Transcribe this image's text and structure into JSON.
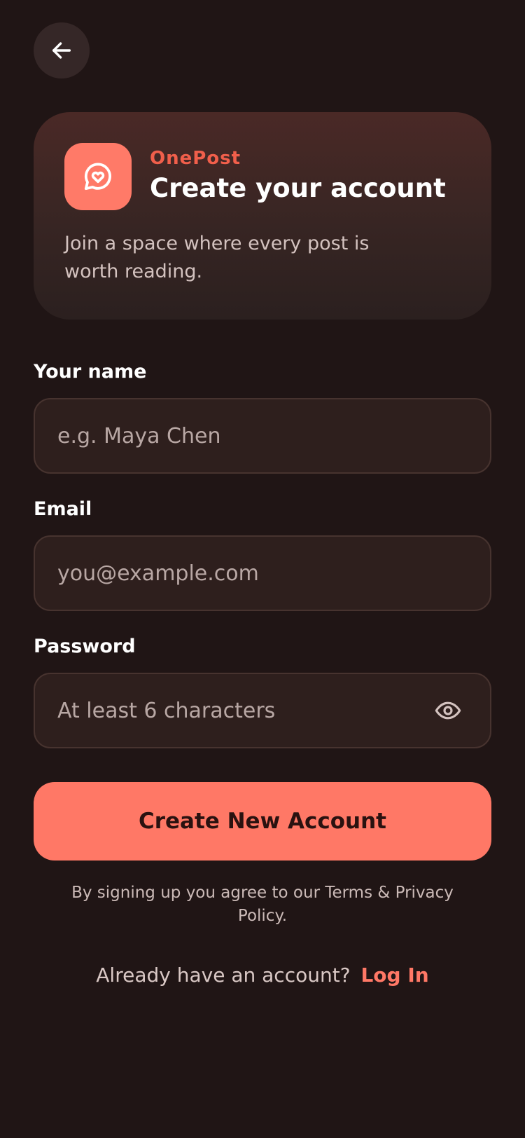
{
  "header": {
    "back_icon": "arrow-left-icon"
  },
  "hero": {
    "logo_icon": "chat-heart-icon",
    "brand": "OnePost",
    "title": "Create your account",
    "subtitle": "Join a space where every post is worth reading."
  },
  "form": {
    "name": {
      "label": "Your name",
      "placeholder": "e.g. Maya Chen",
      "value": ""
    },
    "email": {
      "label": "Email",
      "placeholder": "you@example.com",
      "value": ""
    },
    "password": {
      "label": "Password",
      "placeholder": "At least 6 characters",
      "value": "",
      "toggle_icon": "eye-icon"
    },
    "submit_label": "Create New Account"
  },
  "footer": {
    "terms": "By signing up you agree to our Terms & Privacy Policy.",
    "login_prompt": "Already have an account?",
    "login_link": "Log In"
  },
  "colors": {
    "background": "#201515",
    "accent": "#ff7866",
    "brand_text": "#f15f4b"
  }
}
